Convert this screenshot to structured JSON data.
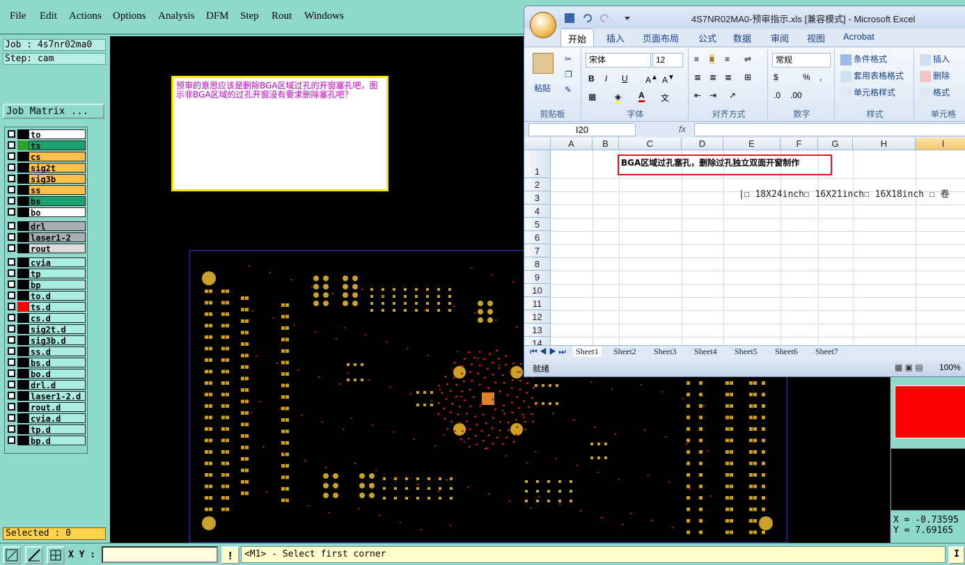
{
  "menu": [
    "File",
    "Edit",
    "Actions",
    "Options",
    "Analysis",
    "DFM",
    "Step",
    "Rout",
    "Windows"
  ],
  "job": {
    "job_label": "Job : 4s7nr02ma0",
    "step_label": "Step: cam",
    "matrix_button": "Job Matrix ..."
  },
  "layers": [
    {
      "name": "to",
      "color": "#ffffff",
      "sw": "#000000"
    },
    {
      "name": "ts",
      "color": "#1aa36f",
      "sw": "#2ea02e"
    },
    {
      "name": "cs",
      "color": "#ffc04a",
      "sw": "#000000"
    },
    {
      "name": "sig2t",
      "color": "#ffc04a",
      "sw": "#000000"
    },
    {
      "name": "sig3b",
      "color": "#ffc04a",
      "sw": "#000000"
    },
    {
      "name": "ss",
      "color": "#ffc04a",
      "sw": "#000000"
    },
    {
      "name": "bs",
      "color": "#1aa36f",
      "sw": "#000000"
    },
    {
      "name": "bo",
      "color": "#ffffff",
      "sw": "#000000"
    },
    {
      "name": "drl",
      "color": "#a8b0b4",
      "sw": "#000000"
    },
    {
      "name": "laser1-2",
      "color": "#a8b0b4",
      "sw": "#000000"
    },
    {
      "name": "rout",
      "color": "#dcdcdc",
      "sw": "#000000"
    },
    {
      "name": "cvia",
      "color": "#a9ece1",
      "sw": "#000000"
    },
    {
      "name": "tp",
      "color": "#a9ece1",
      "sw": "#000000"
    },
    {
      "name": "bp",
      "color": "#a9ece1",
      "sw": "#000000"
    },
    {
      "name": "to.d",
      "color": "#a9ece1",
      "sw": "#000000"
    },
    {
      "name": "ts.d",
      "color": "#a9ece1",
      "sw": "#ff0000"
    },
    {
      "name": "cs.d",
      "color": "#a9ece1",
      "sw": "#000000"
    },
    {
      "name": "sig2t.d",
      "color": "#a9ece1",
      "sw": "#000000"
    },
    {
      "name": "sig3b.d",
      "color": "#a9ece1",
      "sw": "#000000"
    },
    {
      "name": "ss.d",
      "color": "#a9ece1",
      "sw": "#000000"
    },
    {
      "name": "bs.d",
      "color": "#a9ece1",
      "sw": "#000000"
    },
    {
      "name": "bo.d",
      "color": "#a9ece1",
      "sw": "#000000"
    },
    {
      "name": "drl.d",
      "color": "#a9ece1",
      "sw": "#000000"
    },
    {
      "name": "laser1-2.d",
      "color": "#a9ece1",
      "sw": "#000000"
    },
    {
      "name": "rout.d",
      "color": "#a9ece1",
      "sw": "#000000"
    },
    {
      "name": "cvia.d",
      "color": "#a9ece1",
      "sw": "#000000"
    },
    {
      "name": "tp.d",
      "color": "#a9ece1",
      "sw": "#000000"
    },
    {
      "name": "bp.d",
      "color": "#a9ece1",
      "sw": "#000000"
    }
  ],
  "selected": "Selected : 0",
  "note": "预审的意思应该是删除BGA区域过孔的开窗塞孔吧，图示非BGA区域的过孔开窗没有要求删除塞孔吧？",
  "coords": {
    "x": "X = -0.73595",
    "y": "Y = 7.69165"
  },
  "status": {
    "xy_label": "X Y :",
    "message": "<M1> - Select first corner",
    "right_btn": "I"
  },
  "excel": {
    "title": "4S7NR02MA0-预审指示.xls  [兼容模式] - Microsoft Excel",
    "tabs": [
      "开始",
      "插入",
      "页面布局",
      "公式",
      "数据",
      "审阅",
      "视图",
      "Acrobat"
    ],
    "paste": "粘贴",
    "font_name": "宋体",
    "font_size": "12",
    "number_format": "常规",
    "groups": [
      "剪贴板",
      "字体",
      "对齐方式",
      "数字",
      "样式",
      "单元格"
    ],
    "style_btns": [
      "条件格式",
      "套用表格格式",
      "单元格样式"
    ],
    "cell_btns": [
      "插入",
      "删除",
      "格式"
    ],
    "namebox": "I20",
    "fx": "fx",
    "columns": [
      "A",
      "B",
      "C",
      "D",
      "E",
      "F",
      "G",
      "H",
      "I"
    ],
    "rows": [
      "1",
      "2",
      "3",
      "4",
      "5",
      "6",
      "7",
      "8",
      "9",
      "10",
      "11",
      "12",
      "13",
      "14"
    ],
    "c1": "BGA区域过孔塞孔，删除过孔独立双面开窗制作",
    "row2": "|☐ 18X24inch☐ 16X21inch☐ 16X18inch  ☐ 卷",
    "sheets": [
      "Sheet1",
      "Sheet2",
      "Sheet3",
      "Sheet4",
      "Sheet5",
      "Sheet6",
      "Sheet7"
    ],
    "ready": "就绪",
    "zoom": "100%"
  }
}
